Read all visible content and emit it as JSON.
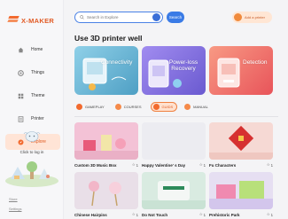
{
  "brand": {
    "name": "X-MAKER",
    "accent": "#f26a2e"
  },
  "search": {
    "placeholder": "Search in Explore",
    "button_label": "Search"
  },
  "header": {
    "add_printer_label": "Add a printer"
  },
  "sidebar": {
    "items": [
      {
        "label": "Home",
        "icon": "home-icon",
        "active": false
      },
      {
        "label": "Things",
        "icon": "things-icon",
        "active": false
      },
      {
        "label": "Theme",
        "icon": "theme-icon",
        "active": false
      },
      {
        "label": "Printer",
        "icon": "printer-icon",
        "active": false
      },
      {
        "label": "Explore",
        "icon": "explore-icon",
        "active": true
      }
    ],
    "login_label": "Click to log in",
    "footer_links": [
      "Store",
      "Settings"
    ]
  },
  "main": {
    "title": "Use 3D printer well",
    "banners": [
      {
        "label": "Connectivity",
        "color": "#5aa6c8"
      },
      {
        "label": "Power-loss Recovery",
        "color": "#7b6ed6"
      },
      {
        "label": "Detection",
        "color": "#ef6b62"
      }
    ],
    "tabs": [
      {
        "label": "GAMEPLAY",
        "active": false
      },
      {
        "label": "COURSES",
        "active": false
      },
      {
        "label": "GUIDS",
        "active": true
      },
      {
        "label": "MANUAL",
        "active": false
      }
    ],
    "cards": [
      {
        "title": "Custom 3D Music Box",
        "favorites": "1",
        "badge": ""
      },
      {
        "title": "Happy Valentine' s Day",
        "favorites": "1",
        "badge": ""
      },
      {
        "title": "Fu Characters",
        "favorites": "1",
        "badge": ""
      },
      {
        "title": "Chinese Hairpins",
        "favorites": "1",
        "badge": ""
      },
      {
        "title": "Do Not Touch",
        "favorites": "1",
        "badge": ""
      },
      {
        "title": "Prehistoric Park",
        "favorites": "1",
        "badge": ""
      }
    ]
  }
}
